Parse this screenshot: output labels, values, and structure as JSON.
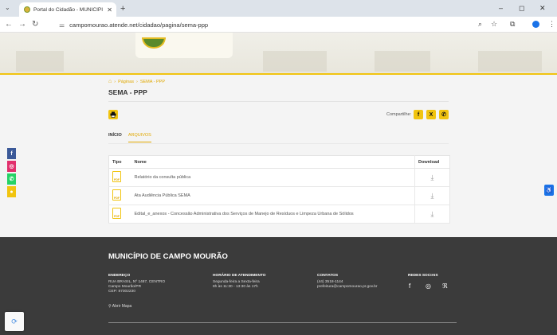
{
  "browser": {
    "tab_title": "Portal do Cidadão - MUNICIPI",
    "tab_close": "✕",
    "new_tab": "+",
    "url": "campomourao.atende.net/cidadao/pagina/sema-ppp",
    "controls": {
      "minimize": "–",
      "maximize": "◻",
      "close": "✕"
    }
  },
  "breadcrumb": {
    "items": [
      "Páginas",
      "SEMA - PPP"
    ],
    "separator": "›"
  },
  "page": {
    "title": "SEMA - PPP"
  },
  "share": {
    "label": "Compartilhe:",
    "buttons": [
      {
        "icon": "facebook-icon",
        "glyph": "f"
      },
      {
        "icon": "x-twitter-icon",
        "glyph": "X"
      },
      {
        "icon": "whatsapp-icon",
        "glyph": "✆"
      }
    ]
  },
  "tabs": [
    "INÍCIO",
    "ARQUIVOS"
  ],
  "files_table": {
    "headers": {
      "type": "Tipo",
      "name": "Nome",
      "download": "Download"
    },
    "rows": [
      {
        "name": "Relatório da consulta pública"
      },
      {
        "name": "Ata Audiência Pública SEMA"
      },
      {
        "name": "Edital_e_anexos - Concessão Administrativa dos Serviços de Manejo de Resíduos e Limpeza Urbana de Sólidos"
      }
    ]
  },
  "side_social": [
    {
      "icon": "facebook-icon",
      "color": "#3b5998",
      "glyph": "f"
    },
    {
      "icon": "instagram-icon",
      "color": "#e1306c",
      "glyph": "◎"
    },
    {
      "icon": "whatsapp-icon",
      "color": "#25d366",
      "glyph": "✆"
    },
    {
      "icon": "chat-icon",
      "color": "#f1c40f",
      "glyph": "●"
    }
  ],
  "footer": {
    "title": "MUNICÍPIO DE CAMPO MOURÃO",
    "address": {
      "head": "ENDEREÇO",
      "lines": [
        "RUA BRASIL, Nº 1487, CENTRO",
        "Campo Mourão/PR",
        "CEP: 87302230"
      ]
    },
    "hours": {
      "head": "HORÁRIO DE ATENDIMENTO",
      "lines": [
        "Segunda-feira a Sexta-feira",
        "8h às 11:30 - 13:30 às 17h"
      ]
    },
    "contacts": {
      "head": "CONTATOS",
      "lines": [
        "(44) 3518-1144",
        "prefeitura@campomourao.pr.gov.br"
      ]
    },
    "social": {
      "head": "REDES SOCIAIS",
      "icons": [
        "facebook-icon",
        "instagram-icon",
        "rss-icon"
      ]
    },
    "map_link": "Abrir Mapa"
  },
  "colors": {
    "accent": "#f1c40f",
    "footer_bg": "#3b3b3b",
    "link": "#e0a800"
  }
}
